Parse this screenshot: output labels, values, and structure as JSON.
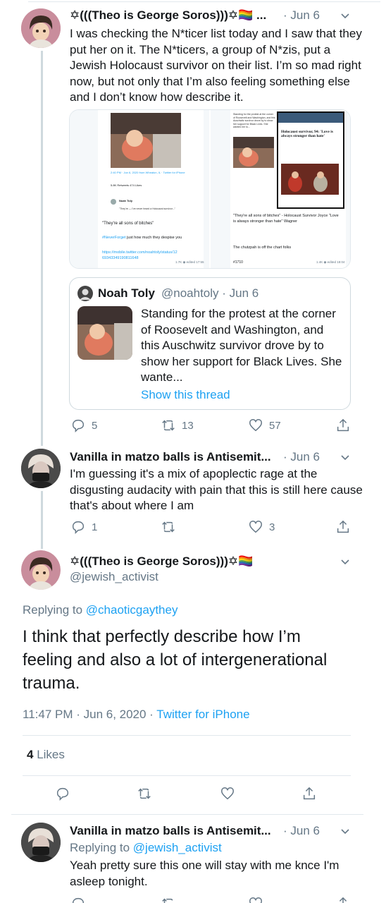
{
  "tweet1": {
    "display_name": "✡(((Theo is George Soros)))✡🏳️‍🌈 ...",
    "time": "· Jun 6",
    "text": "I was checking the N*ticer list today and I saw that they put her on it. The N*ticers, a group of N*zis, put a Jewish Holocaust survivor on their list. I’m so mad right now, but not only that I’m also feeling something else and I don’t know how describe it.",
    "media_left": {
      "caption1": "\"They're all sons of bitches\"",
      "hashtag": "#NeverForget",
      "caption2": "just how much they despise you",
      "url": "https://mobile.twitter.com/noahtoly/status/12 69343349190811648",
      "footer": "1.7K ◉ edited 17:55",
      "inner_meta": "2:40 PM · Jun 6, 2020 from Wheaton, IL · Twitter for iPhone",
      "inner_stats": "5.8K Retweets   474 Likes",
      "inner_name": "Noah Toly",
      "inner_reply": "\"They're — I've never heard a Holocaust survivor...\""
    },
    "media_right": {
      "headline": "Holocaust survivor, 94: 'Love is always stronger than hate'",
      "caption1": "\"They're all sons of bitches\" - Holocaust Survivor Joyce \"Love is always stronger than hate\" Wagner",
      "caption2": "The chutzpah is off the chart folks",
      "tag": "#1710",
      "footer": "1.4K ◉ edited 18:04",
      "small_text": "Standing for the protest at the corner of Roosevelt and Washington, and this Auschwitz survivor drove by to show her support for Black Lives. She wanted me to..."
    },
    "quote": {
      "name": "Noah Toly",
      "handle": "@noahtoly · Jun 6",
      "text": "Standing for the protest at the corner of Roosevelt and Washington, and this Auschwitz survivor drove by to show her support for Black Lives. She wante...",
      "show_thread": "Show this thread"
    },
    "actions": {
      "replies": "5",
      "retweets": "13",
      "likes": "57"
    }
  },
  "tweet2": {
    "display_name": "Vanilla in matzo balls is Antisemit...",
    "time": "· Jun 6",
    "text": "I'm guessing it's a mix of apoplectic rage at the disgusting audacity with pain that this is still here cause that's about where I am",
    "actions": {
      "replies": "1",
      "retweets": "",
      "likes": "3"
    }
  },
  "main_tweet": {
    "display_name": "✡(((Theo is George Soros)))✡🏳️‍🌈",
    "handle": "@jewish_activist",
    "replying_prefix": "Replying to",
    "replying_to": "@chaoticgaythey",
    "text": "I think that perfectly describe how I’m feeling and also a lot of intergenerational trauma.",
    "timestamp": "11:47 PM · Jun 6, 2020 ·",
    "source": "Twitter for iPhone",
    "likes_count": "4",
    "likes_label": "Likes"
  },
  "tweet3": {
    "display_name": "Vanilla in matzo balls is Antisemit...",
    "time": "· Jun 6",
    "replying_prefix": "Replying to",
    "replying_to": "@jewish_activist",
    "text": "Yeah pretty sure this one will stay with me knce I'm asleep tonight."
  },
  "colors": {
    "link": "#1da1f2",
    "secondary": "#657786",
    "border": "#e1e8ed"
  }
}
